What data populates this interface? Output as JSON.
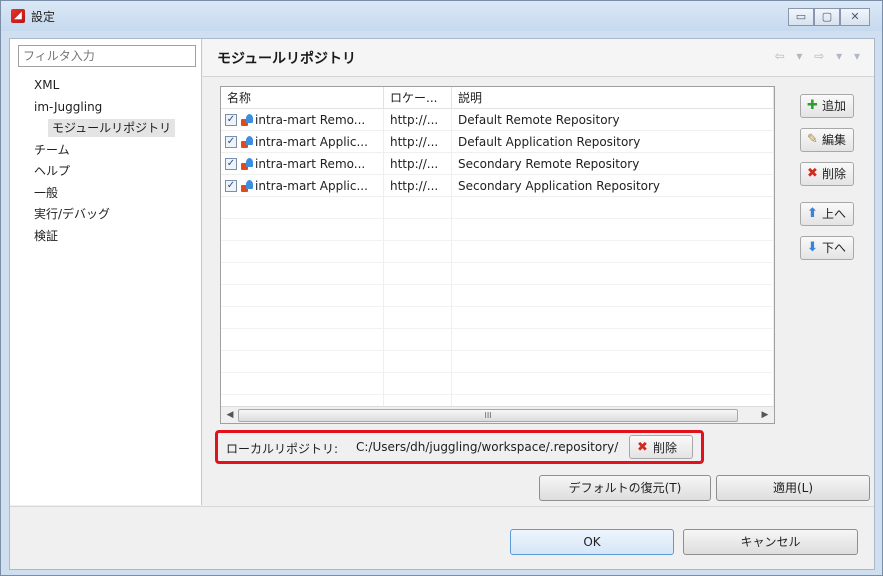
{
  "window": {
    "title": "設定",
    "controls": {
      "minimize": "▭",
      "maximize": "▢",
      "close": "✕"
    }
  },
  "sidebar": {
    "filter_placeholder": "フィルタ入力",
    "items": [
      {
        "label": "XML",
        "level": 0
      },
      {
        "label": "im-Juggling",
        "level": 0
      },
      {
        "label": "モジュールリポジトリ",
        "level": 1,
        "selected": true
      },
      {
        "label": "チーム",
        "level": 0
      },
      {
        "label": "ヘルプ",
        "level": 0
      },
      {
        "label": "一般",
        "level": 0
      },
      {
        "label": "実行/デバッグ",
        "level": 0
      },
      {
        "label": "検証",
        "level": 0
      }
    ]
  },
  "page": {
    "title": "モジュールリポジトリ",
    "nav": "⇦ ▾ ⇨ ▾ ▾"
  },
  "table": {
    "columns": [
      "名称",
      "ロケー...",
      "説明"
    ],
    "rows": [
      {
        "checked": true,
        "name": "intra-mart Remo...",
        "location": "http://...",
        "description": "Default Remote Repository"
      },
      {
        "checked": true,
        "name": "intra-mart Applic...",
        "location": "http://...",
        "description": "Default Application Repository"
      },
      {
        "checked": true,
        "name": "intra-mart Remo...",
        "location": "http://...",
        "description": "Secondary Remote Repository"
      },
      {
        "checked": true,
        "name": "intra-mart Applic...",
        "location": "http://...",
        "description": "Secondary Application Repository"
      }
    ],
    "scroll_grip": "III"
  },
  "side_buttons": {
    "add": "追加",
    "edit": "編集",
    "delete": "削除",
    "up": "上へ",
    "down": "下へ"
  },
  "local_repository": {
    "label": "ローカルリポジトリ:",
    "path": "C:/Users/dh/juggling/workspace/.repository/",
    "delete_label": "削除"
  },
  "buttons": {
    "restore_defaults": "デフォルトの復元(T)",
    "apply": "適用(L)",
    "ok": "OK",
    "cancel": "キャンセル"
  }
}
